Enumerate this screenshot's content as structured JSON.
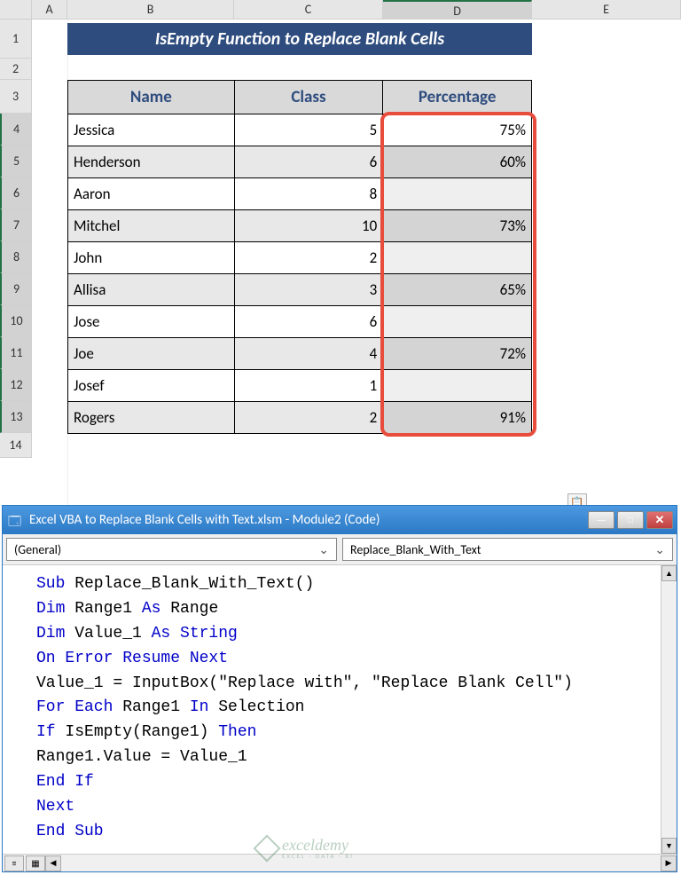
{
  "columns": [
    "A",
    "B",
    "C",
    "D",
    "E"
  ],
  "row_numbers": [
    1,
    2,
    3,
    4,
    5,
    6,
    7,
    8,
    9,
    10,
    11,
    12,
    13,
    14
  ],
  "title_banner": "IsEmpty Function to Replace Blank Cells",
  "table": {
    "headers": {
      "name": "Name",
      "class": "Class",
      "pct": "Percentage"
    },
    "rows": [
      {
        "name": "Jessica",
        "class": "5",
        "pct": "75%"
      },
      {
        "name": "Henderson",
        "class": "6",
        "pct": "60%"
      },
      {
        "name": "Aaron",
        "class": "8",
        "pct": ""
      },
      {
        "name": "Mitchel",
        "class": "10",
        "pct": "73%"
      },
      {
        "name": "John",
        "class": "2",
        "pct": ""
      },
      {
        "name": "Allisa",
        "class": "3",
        "pct": "65%"
      },
      {
        "name": "Jose",
        "class": "6",
        "pct": ""
      },
      {
        "name": "Joe",
        "class": "4",
        "pct": "72%"
      },
      {
        "name": "Josef",
        "class": "1",
        "pct": ""
      },
      {
        "name": "Rogers",
        "class": "2",
        "pct": "91%"
      }
    ]
  },
  "vba": {
    "window_title": "Excel VBA to Replace Blank Cells with Text.xlsm - Module2 (Code)",
    "dd_left": "(General)",
    "dd_right": "Replace_Blank_With_Text",
    "code_tokens": [
      [
        [
          "kw",
          "Sub"
        ],
        [
          "",
          " Replace_Blank_With_Text()"
        ]
      ],
      [
        [
          "kw",
          "Dim"
        ],
        [
          "",
          " Range1 "
        ],
        [
          "kw",
          "As"
        ],
        [
          "",
          " Range"
        ]
      ],
      [
        [
          "kw",
          "Dim"
        ],
        [
          "",
          " Value_1 "
        ],
        [
          "kw",
          "As String"
        ]
      ],
      [
        [
          "kw",
          "On Error Resume Next"
        ]
      ],
      [
        [
          "",
          "Value_1 = InputBox(\"Replace with\", \"Replace Blank Cell\")"
        ]
      ],
      [
        [
          "kw",
          "For Each"
        ],
        [
          "",
          " Range1 "
        ],
        [
          "kw",
          "In"
        ],
        [
          "",
          " Selection"
        ]
      ],
      [
        [
          "kw",
          "If"
        ],
        [
          "",
          " IsEmpty(Range1) "
        ],
        [
          "kw",
          "Then"
        ]
      ],
      [
        [
          "",
          "Range1.Value = Value_1"
        ]
      ],
      [
        [
          "kw",
          "End If"
        ]
      ],
      [
        [
          "kw",
          "Next"
        ]
      ],
      [
        [
          "kw",
          "End Sub"
        ]
      ]
    ]
  },
  "window_buttons": {
    "min": "—",
    "max": "□",
    "close": "✕"
  },
  "scroll": {
    "up": "▲",
    "down": "▼",
    "left": "◀",
    "right": "▶"
  },
  "watermark": {
    "brand": "exceldemy",
    "sub": "EXCEL · DATA · BI"
  },
  "paste_icon_glyph": "📋"
}
